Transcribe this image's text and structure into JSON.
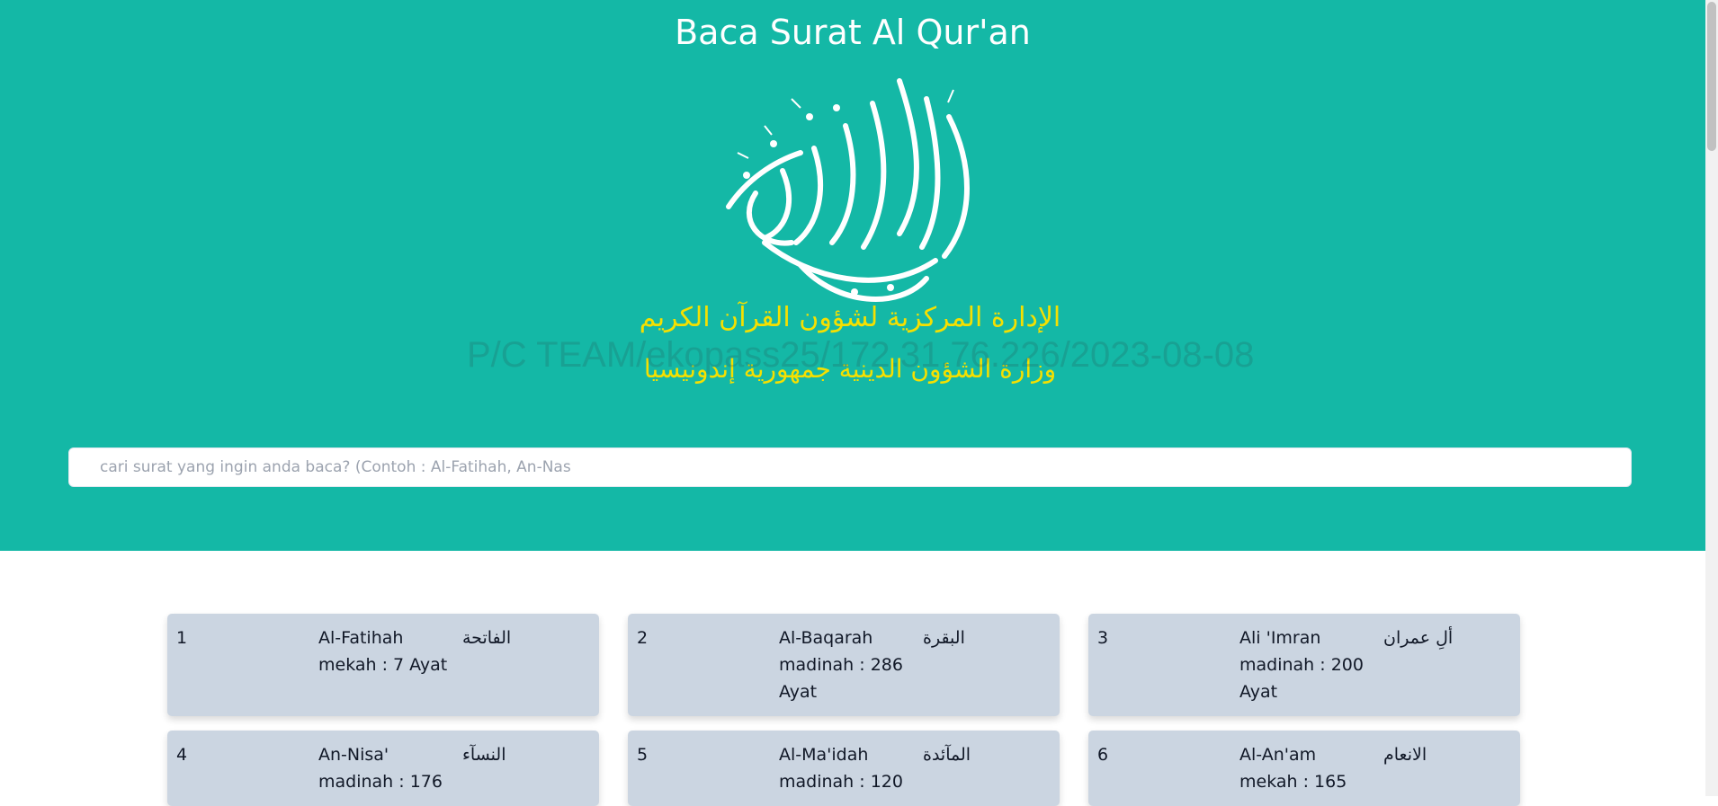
{
  "header": {
    "title": "Baca Surat Al Qur'an",
    "logo_icon": "al-quran-al-karim-calligraphy-logo",
    "logo_line1": "الإدارة المركزية لشؤون القرآن الكريم",
    "logo_line2": "وزارة الشؤون الدينية جمهورية إندونيسيا",
    "watermark": "P/C TEAM/ekopass25/172.31.76.226/2023-08-08"
  },
  "search": {
    "placeholder": "cari surat yang ingin anda baca? (Contoh : Al-Fatihah, An-Nas",
    "value": ""
  },
  "surahs": [
    {
      "number": "1",
      "name": "Al-Fatihah",
      "arabic": "الفاتحة",
      "info": "mekah : 7 Ayat"
    },
    {
      "number": "2",
      "name": "Al-Baqarah",
      "arabic": "البقرة",
      "info": "madinah : 286 Ayat"
    },
    {
      "number": "3",
      "name": "Ali 'Imran",
      "arabic": "ألِ عمران",
      "info": "madinah : 200 Ayat"
    },
    {
      "number": "4",
      "name": "An-Nisa'",
      "arabic": "النسآء",
      "info": "madinah : 176"
    },
    {
      "number": "5",
      "name": "Al-Ma'idah",
      "arabic": "المآئدة",
      "info": "madinah : 120"
    },
    {
      "number": "6",
      "name": "Al-An'am",
      "arabic": "الانعام",
      "info": "mekah : 165"
    }
  ],
  "colors": {
    "hero_bg": "#14b8a6",
    "card_bg": "#cbd5e1",
    "logo_gold": "#f5e000"
  }
}
